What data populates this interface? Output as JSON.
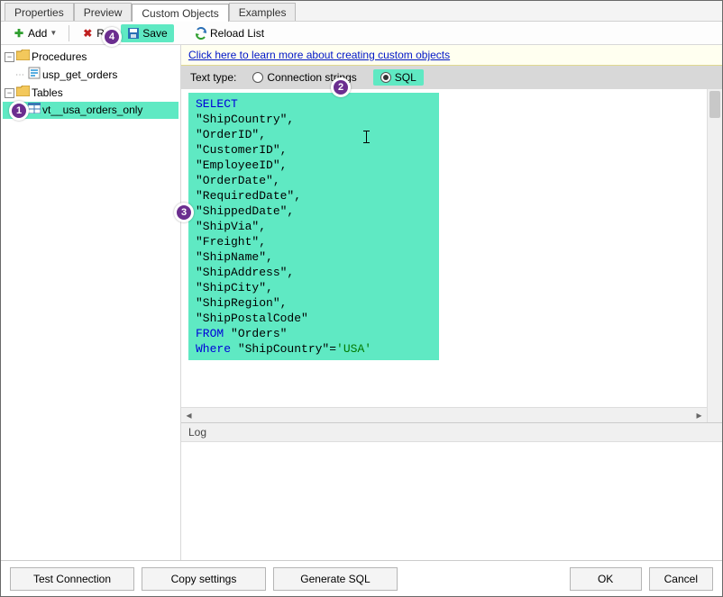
{
  "tabs": {
    "properties": "Properties",
    "preview": "Preview",
    "custom_objects": "Custom Objects",
    "examples": "Examples"
  },
  "toolbar": {
    "add": "Add",
    "remove": "Remove",
    "save": "Save",
    "reload": "Reload List"
  },
  "tree": {
    "procedures": "Procedures",
    "proc_item": "usp_get_orders",
    "tables": "Tables",
    "table_item": "vt__usa_orders_only"
  },
  "info_link": "Click here to learn more about creating custom objects",
  "text_type": {
    "label": "Text type:",
    "conn": "Connection strings",
    "sql": "SQL"
  },
  "sql": {
    "kw_select": "SELECT",
    "l2": "\"ShipCountry\",",
    "l3": "\"OrderID\",",
    "l4": "\"CustomerID\",",
    "l5": "\"EmployeeID\",",
    "l6": "\"OrderDate\",",
    "l7": "\"RequiredDate\",",
    "l8": "\"ShippedDate\",",
    "l9": "\"ShipVia\",",
    "l10": "\"Freight\",",
    "l11": "\"ShipName\",",
    "l12": "\"ShipAddress\",",
    "l13": "\"ShipCity\",",
    "l14": "\"ShipRegion\",",
    "l15": "\"ShipPostalCode\"",
    "kw_from": "FROM",
    "from_tbl": " \"Orders\"",
    "kw_where": "Where",
    "where_col": " \"ShipCountry\"",
    "where_op": "=",
    "where_val": "'USA'"
  },
  "log": {
    "header": "Log"
  },
  "footer": {
    "test": "Test Connection",
    "copy": "Copy settings",
    "gensql": "Generate SQL",
    "ok": "OK",
    "cancel": "Cancel"
  },
  "badges": {
    "b1": "1",
    "b2": "2",
    "b3": "3",
    "b4": "4"
  }
}
